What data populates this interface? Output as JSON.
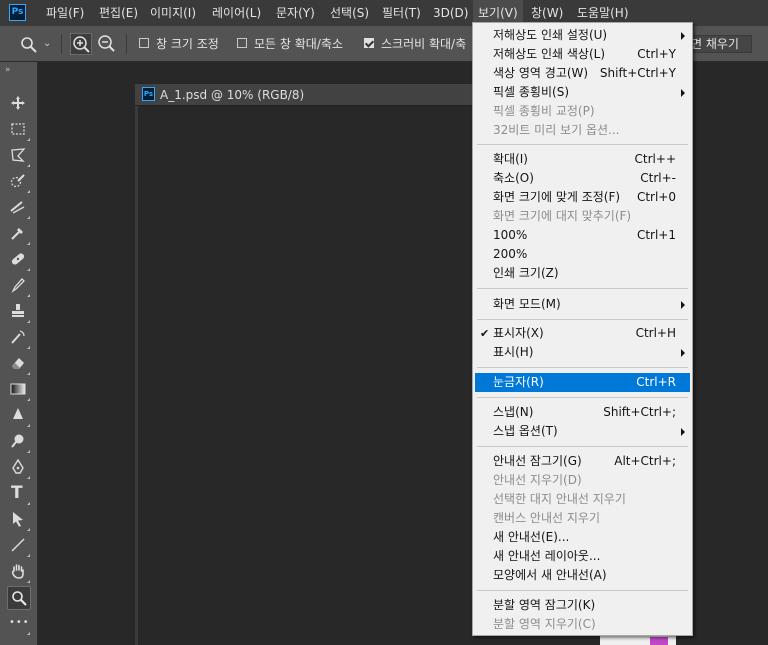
{
  "app_logo": "Ps",
  "menubar": {
    "items": [
      "파일(F)",
      "편집(E)",
      "이미지(I)",
      "레이어(L)",
      "문자(Y)",
      "선택(S)",
      "필터(T)",
      "3D(D)",
      "보기(V)",
      "창(W)",
      "도움말(H)"
    ]
  },
  "options": {
    "dropdown_caret": "⌄",
    "resize_windows": "창 크기 조정",
    "zoom_all": "모든 창 확대/축소",
    "scrubby": "스크러비 확대/축",
    "fill_screen": "면 채우기"
  },
  "toolbar": {
    "collapse": "»",
    "tools": [
      "move-tool",
      "rectangular-marquee-tool",
      "lasso-tool",
      "quick-selection-tool",
      "crop-tool",
      "eyedropper-tool",
      "healing-brush-tool",
      "brush-tool",
      "clone-stamp-tool",
      "history-brush-tool",
      "eraser-tool",
      "gradient-tool",
      "blur-tool",
      "dodge-tool",
      "pen-tool",
      "type-tool",
      "path-selection-tool",
      "line-tool",
      "hand-tool",
      "zoom-tool",
      "more-tools"
    ],
    "type_glyph": "T",
    "more_glyph": "•••"
  },
  "document": {
    "icon": "Ps",
    "title": "A_1.psd @ 10% (RGB/8)"
  },
  "view_menu": {
    "items": [
      {
        "label": "저해상도 인쇄 설정(U)",
        "shortcut": "",
        "submenu": true,
        "disabled": false
      },
      {
        "label": "저해상도 인쇄 색상(L)",
        "shortcut": "Ctrl+Y",
        "submenu": false,
        "disabled": false
      },
      {
        "label": "색상 영역 경고(W)",
        "shortcut": "Shift+Ctrl+Y",
        "submenu": false,
        "disabled": false
      },
      {
        "label": "픽셀 종횡비(S)",
        "shortcut": "",
        "submenu": true,
        "disabled": false
      },
      {
        "label": "픽셀 종횡비 교정(P)",
        "shortcut": "",
        "submenu": false,
        "disabled": true
      },
      {
        "label": "32비트 미리 보기 옵션...",
        "shortcut": "",
        "submenu": false,
        "disabled": true
      },
      {
        "label": "확대(I)",
        "shortcut": "Ctrl++",
        "submenu": false,
        "disabled": false
      },
      {
        "label": "축소(O)",
        "shortcut": "Ctrl+-",
        "submenu": false,
        "disabled": false
      },
      {
        "label": "화면 크기에 맞게 조정(F)",
        "shortcut": "Ctrl+0",
        "submenu": false,
        "disabled": false
      },
      {
        "label": "화면 크기에 대지 맞추기(F)",
        "shortcut": "",
        "submenu": false,
        "disabled": true
      },
      {
        "label": "100%",
        "shortcut": "Ctrl+1",
        "submenu": false,
        "disabled": false
      },
      {
        "label": "200%",
        "shortcut": "",
        "submenu": false,
        "disabled": false
      },
      {
        "label": "인쇄 크기(Z)",
        "shortcut": "",
        "submenu": false,
        "disabled": false
      },
      {
        "label": "화면 모드(M)",
        "shortcut": "",
        "submenu": true,
        "disabled": false
      },
      {
        "label": "표시자(X)",
        "shortcut": "Ctrl+H",
        "submenu": false,
        "disabled": false,
        "checked": true
      },
      {
        "label": "표시(H)",
        "shortcut": "",
        "submenu": true,
        "disabled": false
      },
      {
        "label": "눈금자(R)",
        "shortcut": "Ctrl+R",
        "submenu": false,
        "disabled": false,
        "highlighted": true
      },
      {
        "label": "스냅(N)",
        "shortcut": "Shift+Ctrl+;",
        "submenu": false,
        "disabled": false
      },
      {
        "label": "스냅 옵션(T)",
        "shortcut": "",
        "submenu": true,
        "disabled": false
      },
      {
        "label": "안내선 잠그기(G)",
        "shortcut": "Alt+Ctrl+;",
        "submenu": false,
        "disabled": false
      },
      {
        "label": "안내선 지우기(D)",
        "shortcut": "",
        "submenu": false,
        "disabled": true
      },
      {
        "label": "선택한 대지 안내선 지우기",
        "shortcut": "",
        "submenu": false,
        "disabled": true
      },
      {
        "label": "캔버스 안내선 지우기",
        "shortcut": "",
        "submenu": false,
        "disabled": true
      },
      {
        "label": "새 안내선(E)...",
        "shortcut": "",
        "submenu": false,
        "disabled": false
      },
      {
        "label": "새 안내선 레이아웃...",
        "shortcut": "",
        "submenu": false,
        "disabled": false
      },
      {
        "label": "모양에서 새 안내선(A)",
        "shortcut": "",
        "submenu": false,
        "disabled": false
      },
      {
        "label": "분할 영역 잠그기(K)",
        "shortcut": "",
        "submenu": false,
        "disabled": false
      },
      {
        "label": "분할 영역 지우기(C)",
        "shortcut": "",
        "submenu": false,
        "disabled": true
      }
    ]
  }
}
